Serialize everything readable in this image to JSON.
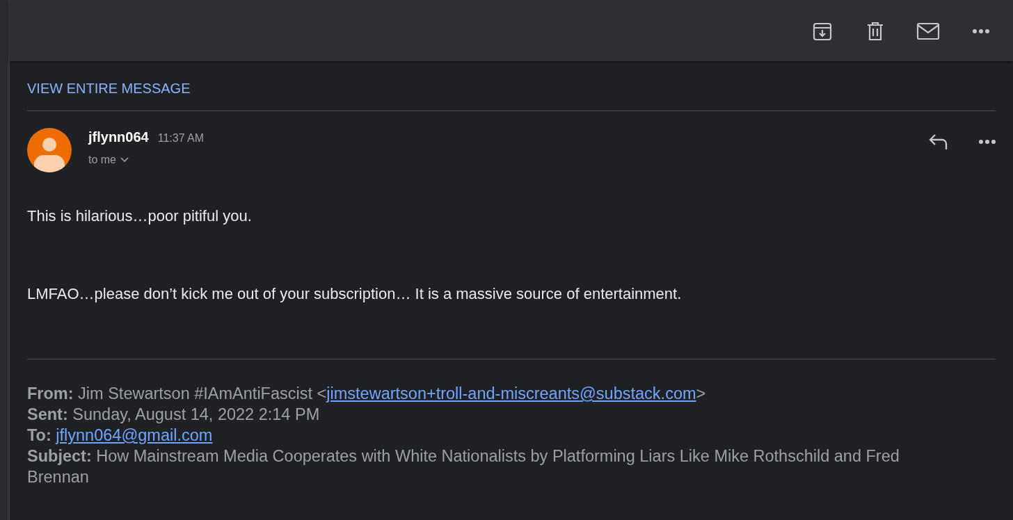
{
  "thread": {
    "view_entire_label": "VIEW ENTIRE MESSAGE"
  },
  "message": {
    "sender": "jflynn064",
    "time": "11:37 AM",
    "recipient": "to me",
    "body": [
      "This is hilarious…poor pitiful you.",
      "LMFAO…please don’t kick me out of your subscription… It is a massive source of entertainment."
    ],
    "quoted_header": [
      {
        "label": "From:",
        "text": "Jim Stewartson #IAmAntiFascist <",
        "link": "jimstewartson+troll-and-miscreants@substack.com",
        "text_after": ">"
      },
      {
        "label": "Sent:",
        "text": "Sunday, August 14, 2022 2:14 PM"
      },
      {
        "label": "To:",
        "link": "jflynn064@gmail.com"
      },
      {
        "label": "Subject:",
        "text": "How Mainstream Media Cooperates with White Nationalists by Platforming Liars Like Mike Rothschild and Fred Brennan"
      }
    ]
  }
}
